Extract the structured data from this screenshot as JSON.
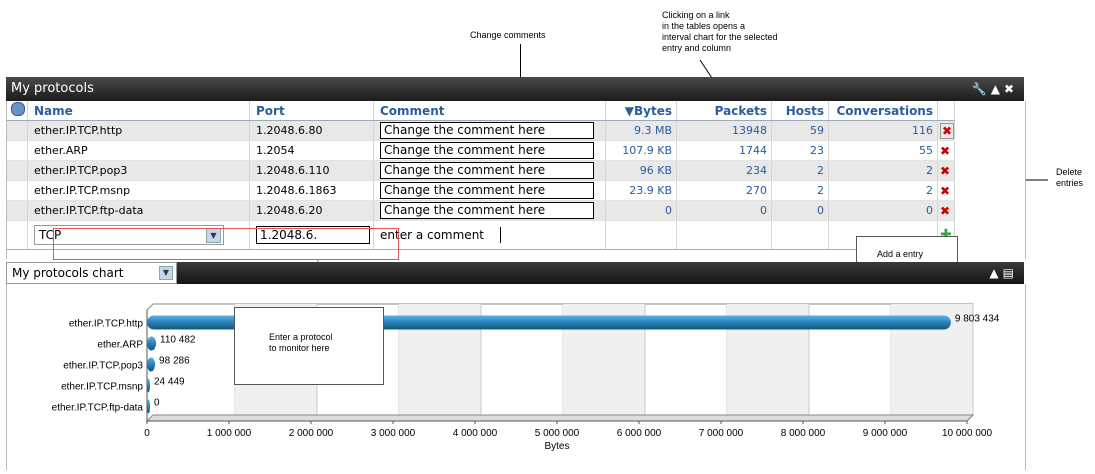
{
  "annotations": {
    "change_comments": "Change comments",
    "clicking_link": [
      "Clicking on a link",
      "in the tables opens a",
      "interval chart for the selected",
      "entry and column"
    ],
    "delete_entries": [
      "Delete",
      "entries"
    ],
    "add_entry": "Add a entry",
    "enter_protocol": [
      "Enter a protocol",
      "to monitor here"
    ]
  },
  "widget": {
    "title": "My protocols",
    "icons": [
      "wrench-icon",
      "collapse-icon",
      "close-icon"
    ]
  },
  "table": {
    "columns": [
      "Name",
      "Port",
      "Comment",
      "Bytes",
      "Packets",
      "Hosts",
      "Conversations"
    ],
    "sort_column": "Bytes",
    "rows": [
      {
        "name": "ether.IP.TCP.http",
        "port": "1.2048.6.80",
        "comment": "Change the comment here",
        "bytes": "9.3 MB",
        "packets": "13948",
        "hosts": "59",
        "conversations": "116"
      },
      {
        "name": "ether.ARP",
        "port": "1.2054",
        "comment": "Change the comment here",
        "bytes": "107.9 KB",
        "packets": "1744",
        "hosts": "23",
        "conversations": "55"
      },
      {
        "name": "ether.IP.TCP.pop3",
        "port": "1.2048.6.110",
        "comment": "Change the comment here",
        "bytes": "96 KB",
        "packets": "234",
        "hosts": "2",
        "conversations": "2"
      },
      {
        "name": "ether.IP.TCP.msnp",
        "port": "1.2048.6.1863",
        "comment": "Change the comment here",
        "bytes": "23.9 KB",
        "packets": "270",
        "hosts": "2",
        "conversations": "2"
      },
      {
        "name": "ether.IP.TCP.ftp-data",
        "port": "1.2048.6.20",
        "comment": "Change the comment here",
        "bytes": "0",
        "packets": "0",
        "hosts": "0",
        "conversations": "0"
      }
    ],
    "add_row": {
      "protocol_value": "TCP",
      "port_value": "1.2048.6.",
      "comment_placeholder": "enter a comment"
    }
  },
  "chart_panel": {
    "title": "My protocols chart"
  },
  "chart_data": {
    "type": "bar",
    "orientation": "horizontal",
    "categories": [
      "ether.IP.TCP.http",
      "ether.ARP",
      "ether.IP.TCP.pop3",
      "ether.IP.TCP.msnp",
      "ether.IP.TCP.ftp-data"
    ],
    "values": [
      9803434,
      110482,
      98286,
      24449,
      0
    ],
    "value_labels": [
      "9 803 434",
      "110 482",
      "98 286",
      "24 449",
      "0"
    ],
    "xlabel": "Bytes",
    "xlim": [
      0,
      10000000
    ],
    "xticks": [
      "0",
      "1 000 000",
      "2 000 000",
      "3 000 000",
      "4 000 000",
      "5 000 000",
      "6 000 000",
      "7 000 000",
      "8 000 000",
      "9 000 000",
      "10 000 000"
    ],
    "bar_color": "#2a7fb5",
    "grid": true
  }
}
